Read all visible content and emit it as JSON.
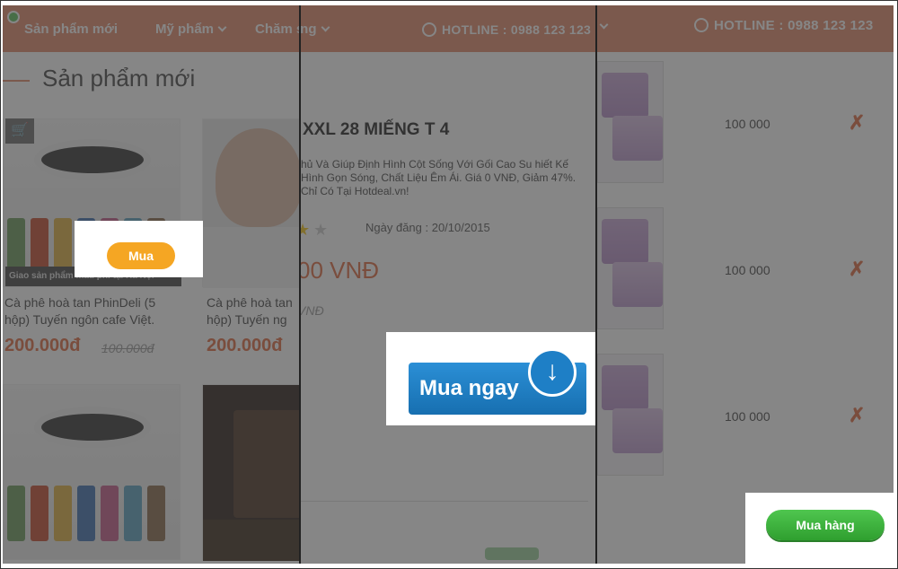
{
  "panel1": {
    "nav": {
      "new_products": "Sản phẩm mới",
      "cosmetics": "Mỹ phẩm",
      "care": "Chăm sóc"
    },
    "section_title": "Sản phẩm mới",
    "banner_text": "Giao sản phẩm mẫu phí tại Hà Nội",
    "mua_label": "Mua",
    "products": [
      {
        "title": "Cà phê hoà tan PhinDeli (5 hộp) Tuyến ngôn cafe Việt.",
        "price": "200.000đ",
        "old_price": "100.000đ"
      },
      {
        "title": "Cà phê hoà tan hộp) Tuyến ng",
        "price": "200.000đ"
      }
    ]
  },
  "panel2": {
    "hotline": "HOTLINE : 0988 123 123",
    "product_title": "XXL 28 MIẾNG T 4",
    "description": "hủ Và Giúp Định Hình Cột Sống Với Gối Cao Su hiết Kế Hình Gọn Sóng, Chất Liệu Êm Ái. Giá 0 VNĐ, Giảm 47%. Chỉ Có Tại Hotdeal.vn!",
    "post_date": "Ngày đăng : 20/10/2015",
    "price": "00 VNĐ",
    "old_price": "VNĐ",
    "buy_now_label": "Mua ngay"
  },
  "panel3": {
    "hotline": "HOTLINE : 0988 123 123",
    "cart_items": [
      {
        "price": "100 000"
      },
      {
        "price": "100 000"
      },
      {
        "price": "100 000"
      }
    ],
    "checkout_label": "Mua hàng"
  },
  "colors": {
    "header": "#e2886b",
    "accent_orange": "#f5a623",
    "price": "#e06a3f",
    "buy_blue": "#1e7fc6",
    "checkout_green": "#3bb33b"
  }
}
